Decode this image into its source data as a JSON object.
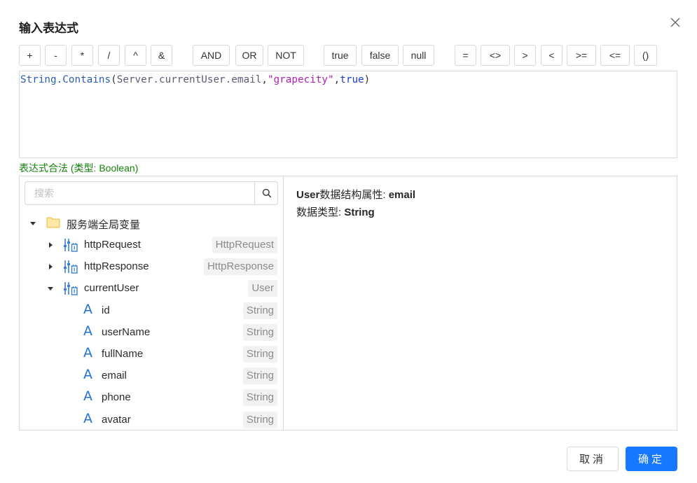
{
  "dialog": {
    "title": "输入表达式",
    "close_icon": "close-icon"
  },
  "operators": [
    "+",
    "-",
    "*",
    "/",
    "^",
    "&",
    "AND",
    "OR",
    "NOT",
    "true",
    "false",
    "null",
    "=",
    "<>",
    ">",
    "<",
    ">=",
    "<=",
    "()"
  ],
  "expression": {
    "fn": "String.Contains",
    "open": "(",
    "var": "Server.currentUser.email",
    "comma1": ",",
    "str": "\"grapecity\"",
    "comma2": ",",
    "kw": "true",
    "close": ")"
  },
  "validation": {
    "text": "表达式合法 (类型: Boolean)",
    "color": "#15820d"
  },
  "search": {
    "placeholder": "搜索",
    "icon": "search-icon"
  },
  "tree": {
    "root": {
      "label": "服务端全局变量",
      "icon": "folder-icon",
      "expanded": true
    },
    "items": [
      {
        "label": "httpRequest",
        "type": "HttpRequest",
        "icon": "variable-icon",
        "expanded": false
      },
      {
        "label": "httpResponse",
        "type": "HttpResponse",
        "icon": "variable-icon",
        "expanded": false
      },
      {
        "label": "currentUser",
        "type": "User",
        "icon": "variable-icon",
        "expanded": true
      }
    ],
    "fields": [
      {
        "label": "id",
        "type": "String",
        "icon": "text-type-icon"
      },
      {
        "label": "userName",
        "type": "String",
        "icon": "text-type-icon"
      },
      {
        "label": "fullName",
        "type": "String",
        "icon": "text-type-icon"
      },
      {
        "label": "email",
        "type": "String",
        "icon": "text-type-icon"
      },
      {
        "label": "phone",
        "type": "String",
        "icon": "text-type-icon"
      },
      {
        "label": "avatar",
        "type": "String",
        "icon": "text-type-icon"
      }
    ]
  },
  "detail": {
    "line1_prefix": "User",
    "line1_label": "数据结构属性: ",
    "line1_value": "email",
    "line2_label": "数据类型: ",
    "line2_value": "String"
  },
  "footer": {
    "cancel_label": "取消",
    "ok_label": "确定",
    "ok_color": "#1677ff"
  }
}
